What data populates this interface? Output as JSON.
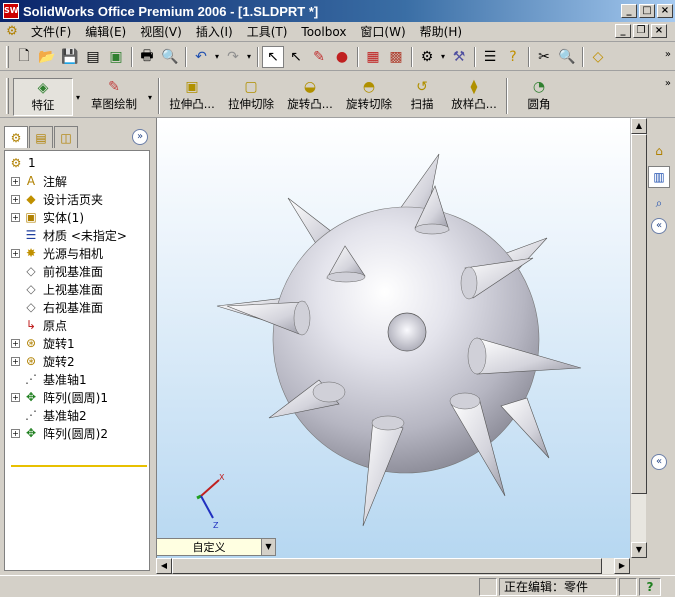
{
  "window": {
    "title": "SolidWorks Office Premium 2006 - [1.SLDPRT *]",
    "app_icon": "SW"
  },
  "menu": {
    "items": [
      "文件(F)",
      "编辑(E)",
      "视图(V)",
      "插入(I)",
      "工具(T)",
      "Toolbox",
      "窗口(W)",
      "帮助(H)"
    ]
  },
  "feature_toolbar": {
    "buttons": [
      {
        "label": "特征",
        "icon": "feature-icon"
      },
      {
        "label": "草图绘制",
        "icon": "sketch-icon"
      },
      {
        "label": "拉伸凸...",
        "icon": "extrude-boss-icon"
      },
      {
        "label": "拉伸切除",
        "icon": "extrude-cut-icon"
      },
      {
        "label": "旋转凸...",
        "icon": "revolve-boss-icon"
      },
      {
        "label": "旋转切除",
        "icon": "revolve-cut-icon"
      },
      {
        "label": "扫描",
        "icon": "sweep-icon"
      },
      {
        "label": "放样凸...",
        "icon": "loft-icon"
      },
      {
        "label": "圆角",
        "icon": "fillet-icon"
      }
    ]
  },
  "tree": {
    "root": "1",
    "items": [
      {
        "label": "注解",
        "icon": "annotation-icon",
        "expand": "+"
      },
      {
        "label": "设计活页夹",
        "icon": "binder-icon",
        "expand": "+"
      },
      {
        "label": "实体(1)",
        "icon": "solid-body-icon",
        "expand": "+"
      },
      {
        "label": "材质 <未指定>",
        "icon": "material-icon",
        "expand": ""
      },
      {
        "label": "光源与相机",
        "icon": "lights-icon",
        "expand": "+"
      },
      {
        "label": "前视基准面",
        "icon": "plane-icon",
        "expand": ""
      },
      {
        "label": "上视基准面",
        "icon": "plane-icon",
        "expand": ""
      },
      {
        "label": "右视基准面",
        "icon": "plane-icon",
        "expand": ""
      },
      {
        "label": "原点",
        "icon": "origin-icon",
        "expand": ""
      },
      {
        "label": "旋转1",
        "icon": "revolve-feature-icon",
        "expand": "+"
      },
      {
        "label": "旋转2",
        "icon": "revolve-feature-icon",
        "expand": "+"
      },
      {
        "label": "基准轴1",
        "icon": "axis-icon",
        "expand": ""
      },
      {
        "label": "阵列(圆周)1",
        "icon": "circular-pattern-icon",
        "expand": "+"
      },
      {
        "label": "基准轴2",
        "icon": "axis-icon",
        "expand": ""
      },
      {
        "label": "阵列(圆周)2",
        "icon": "circular-pattern-icon",
        "expand": "+"
      }
    ]
  },
  "viewport": {
    "view_orientation": "自定义",
    "triad": {
      "x": "X",
      "y": "Y",
      "z": "Z"
    }
  },
  "status": {
    "editing": "正在编辑：零件",
    "help": "?"
  },
  "colors": {
    "title_start": "#0a246a",
    "title_end": "#a6caf0",
    "viewport_bottom": "#b6d7f1"
  }
}
